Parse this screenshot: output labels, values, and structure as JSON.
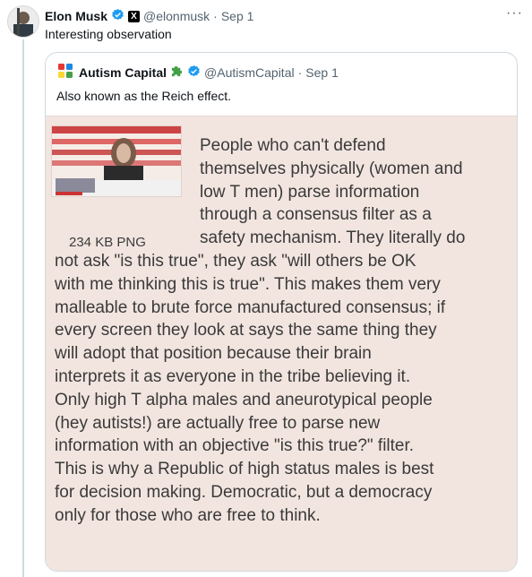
{
  "tweet": {
    "author_name": "Elon Musk",
    "handle": "@elonmusk",
    "date": "Sep 1",
    "affiliation_icon": "x-logo-badge",
    "text": "Interesting observation",
    "more_label": "···"
  },
  "quote": {
    "author_name": "Autism Capital",
    "handle": "@AutismCapital",
    "date": "Sep 1",
    "text": "Also known as the Reich effect.",
    "media": {
      "file_label": "234 KB PNG",
      "lead_lines": [
        "People who can't defend",
        "themselves physically (women and",
        "low T men) parse information",
        "through a consensus filter as a",
        "safety mechanism. They literally do"
      ],
      "body_lines": [
        "not ask \"is this true\", they ask \"will others be OK",
        "with me thinking this is true\". This makes them very",
        "malleable to brute force manufactured consensus; if",
        "every screen they look at says the same thing they",
        "will adopt that position because their brain",
        "interprets it as everyone in the tribe believing it.",
        "Only high T alpha males and aneurotypical people",
        "(hey autists!) are actually free to parse new",
        "information with an objective \"is this true?\" filter.",
        "This is why a Republic of high status males is best",
        "for decision making. Democratic, but a democracy",
        "only for those who are free to think."
      ]
    }
  },
  "colors": {
    "verified_blue": "#1d9bf0",
    "meme_background": "#f2e5df",
    "meme_text": "#3a3a3a",
    "border": "#cfd9de",
    "secondary_text": "#536471"
  }
}
